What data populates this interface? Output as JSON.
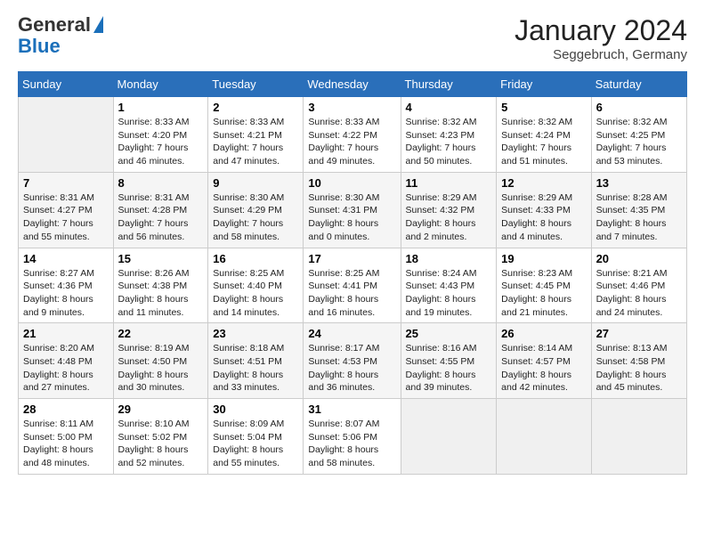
{
  "header": {
    "logo_line1": "General",
    "logo_line2": "Blue",
    "month_year": "January 2024",
    "location": "Seggebruch, Germany"
  },
  "columns": [
    "Sunday",
    "Monday",
    "Tuesday",
    "Wednesday",
    "Thursday",
    "Friday",
    "Saturday"
  ],
  "weeks": [
    [
      {
        "num": "",
        "info": ""
      },
      {
        "num": "1",
        "info": "Sunrise: 8:33 AM\nSunset: 4:20 PM\nDaylight: 7 hours\nand 46 minutes."
      },
      {
        "num": "2",
        "info": "Sunrise: 8:33 AM\nSunset: 4:21 PM\nDaylight: 7 hours\nand 47 minutes."
      },
      {
        "num": "3",
        "info": "Sunrise: 8:33 AM\nSunset: 4:22 PM\nDaylight: 7 hours\nand 49 minutes."
      },
      {
        "num": "4",
        "info": "Sunrise: 8:32 AM\nSunset: 4:23 PM\nDaylight: 7 hours\nand 50 minutes."
      },
      {
        "num": "5",
        "info": "Sunrise: 8:32 AM\nSunset: 4:24 PM\nDaylight: 7 hours\nand 51 minutes."
      },
      {
        "num": "6",
        "info": "Sunrise: 8:32 AM\nSunset: 4:25 PM\nDaylight: 7 hours\nand 53 minutes."
      }
    ],
    [
      {
        "num": "7",
        "info": "Sunrise: 8:31 AM\nSunset: 4:27 PM\nDaylight: 7 hours\nand 55 minutes."
      },
      {
        "num": "8",
        "info": "Sunrise: 8:31 AM\nSunset: 4:28 PM\nDaylight: 7 hours\nand 56 minutes."
      },
      {
        "num": "9",
        "info": "Sunrise: 8:30 AM\nSunset: 4:29 PM\nDaylight: 7 hours\nand 58 minutes."
      },
      {
        "num": "10",
        "info": "Sunrise: 8:30 AM\nSunset: 4:31 PM\nDaylight: 8 hours\nand 0 minutes."
      },
      {
        "num": "11",
        "info": "Sunrise: 8:29 AM\nSunset: 4:32 PM\nDaylight: 8 hours\nand 2 minutes."
      },
      {
        "num": "12",
        "info": "Sunrise: 8:29 AM\nSunset: 4:33 PM\nDaylight: 8 hours\nand 4 minutes."
      },
      {
        "num": "13",
        "info": "Sunrise: 8:28 AM\nSunset: 4:35 PM\nDaylight: 8 hours\nand 7 minutes."
      }
    ],
    [
      {
        "num": "14",
        "info": "Sunrise: 8:27 AM\nSunset: 4:36 PM\nDaylight: 8 hours\nand 9 minutes."
      },
      {
        "num": "15",
        "info": "Sunrise: 8:26 AM\nSunset: 4:38 PM\nDaylight: 8 hours\nand 11 minutes."
      },
      {
        "num": "16",
        "info": "Sunrise: 8:25 AM\nSunset: 4:40 PM\nDaylight: 8 hours\nand 14 minutes."
      },
      {
        "num": "17",
        "info": "Sunrise: 8:25 AM\nSunset: 4:41 PM\nDaylight: 8 hours\nand 16 minutes."
      },
      {
        "num": "18",
        "info": "Sunrise: 8:24 AM\nSunset: 4:43 PM\nDaylight: 8 hours\nand 19 minutes."
      },
      {
        "num": "19",
        "info": "Sunrise: 8:23 AM\nSunset: 4:45 PM\nDaylight: 8 hours\nand 21 minutes."
      },
      {
        "num": "20",
        "info": "Sunrise: 8:21 AM\nSunset: 4:46 PM\nDaylight: 8 hours\nand 24 minutes."
      }
    ],
    [
      {
        "num": "21",
        "info": "Sunrise: 8:20 AM\nSunset: 4:48 PM\nDaylight: 8 hours\nand 27 minutes."
      },
      {
        "num": "22",
        "info": "Sunrise: 8:19 AM\nSunset: 4:50 PM\nDaylight: 8 hours\nand 30 minutes."
      },
      {
        "num": "23",
        "info": "Sunrise: 8:18 AM\nSunset: 4:51 PM\nDaylight: 8 hours\nand 33 minutes."
      },
      {
        "num": "24",
        "info": "Sunrise: 8:17 AM\nSunset: 4:53 PM\nDaylight: 8 hours\nand 36 minutes."
      },
      {
        "num": "25",
        "info": "Sunrise: 8:16 AM\nSunset: 4:55 PM\nDaylight: 8 hours\nand 39 minutes."
      },
      {
        "num": "26",
        "info": "Sunrise: 8:14 AM\nSunset: 4:57 PM\nDaylight: 8 hours\nand 42 minutes."
      },
      {
        "num": "27",
        "info": "Sunrise: 8:13 AM\nSunset: 4:58 PM\nDaylight: 8 hours\nand 45 minutes."
      }
    ],
    [
      {
        "num": "28",
        "info": "Sunrise: 8:11 AM\nSunset: 5:00 PM\nDaylight: 8 hours\nand 48 minutes."
      },
      {
        "num": "29",
        "info": "Sunrise: 8:10 AM\nSunset: 5:02 PM\nDaylight: 8 hours\nand 52 minutes."
      },
      {
        "num": "30",
        "info": "Sunrise: 8:09 AM\nSunset: 5:04 PM\nDaylight: 8 hours\nand 55 minutes."
      },
      {
        "num": "31",
        "info": "Sunrise: 8:07 AM\nSunset: 5:06 PM\nDaylight: 8 hours\nand 58 minutes."
      },
      {
        "num": "",
        "info": ""
      },
      {
        "num": "",
        "info": ""
      },
      {
        "num": "",
        "info": ""
      }
    ]
  ]
}
